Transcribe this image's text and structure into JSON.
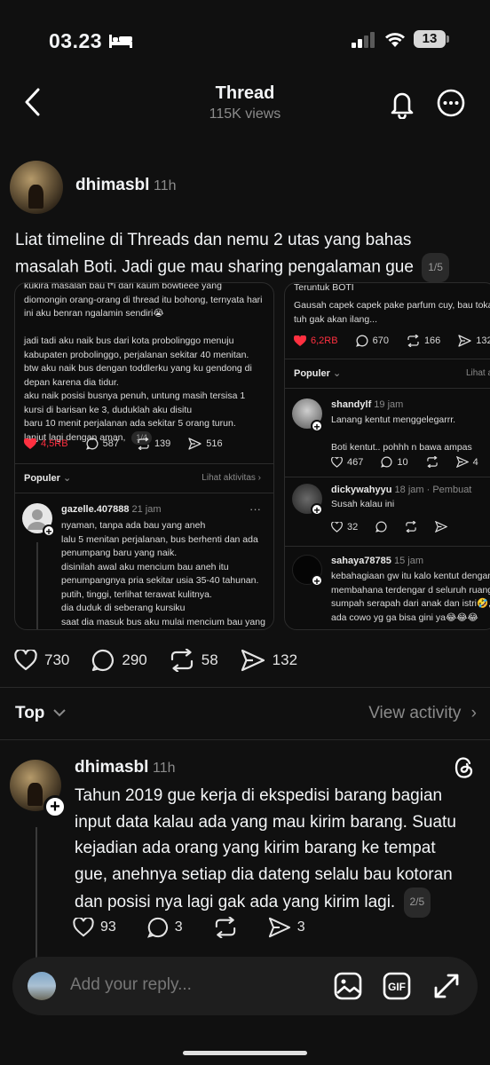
{
  "status_bar": {
    "time": "03.23",
    "battery": "13"
  },
  "header": {
    "title": "Thread",
    "views": "115K views"
  },
  "post": {
    "username": "dhimasbl",
    "time": "11h",
    "text": "Liat timeline di Threads dan nemu 2 utas yang bahas masalah Boti. Jadi gue mau sharing pengalaman gue",
    "pager": "1/5",
    "likes": "730",
    "comments": "290",
    "reposts": "58",
    "shares": "132"
  },
  "shot1": {
    "body": "kukira masalah bau t*i dari kaum bowtieee yang\ndiomongin orang-orang di thread itu bohong, ternyata hari\nini aku benran ngalamin sendiri😭\n\njadi tadi aku naik bus dari kota probolinggo menuju\nkabupaten probolinggo, perjalanan sekitar 40 menitan.\nbtw aku naik bus dengan toddlerku yang ku gendong di\ndepan karena dia tidur.\naku naik posisi busnya penuh, untung masih tersisa 1\nkursi di barisan ke 3, duduklah aku disitu\nbaru 10 menit perjalanan ada sekitar 5 orang turun.\nlanjut lagi dengan aman,",
    "pager": "1/4",
    "likes": "4,5RB",
    "comments": "587",
    "reposts": "139",
    "shares": "516",
    "popular": "Populer",
    "activity": "Lihat aktivitas",
    "reply_user": "gazelle.407888",
    "reply_time": "21 jam",
    "reply_body": "nyaman, tanpa ada bau yang aneh\nlalu 5 menitan perjalanan, bus berhenti dan ada\npenumpang baru yang naik.\ndisinilah awal aku mencium bau aneh itu\npenumpangnya pria sekitar usia 35-40 tahunan.\nputih, tinggi, terlihat terawat kulitnya.\ndia duduk di seberang kursiku\nsaat dia masuk bus aku mulai mencium bau yang\naneh, seperti bau toilet umum, mirip juga dengan"
  },
  "shot2": {
    "header": "Teruntuk BOTI",
    "body": "Gausah capek capek pake parfum cuy, bau tokai k\ntuh gak akan ilang...",
    "likes": "6,2RB",
    "comments": "670",
    "reposts": "166",
    "shares": "132",
    "popular": "Populer",
    "activity": "Lihat at",
    "r1_user": "shandylf",
    "r1_time": "19 jam",
    "r1_body": "Lanang kentut menggelegarrr.\n\nBoti kentut.. pohhh n bawa ampas",
    "r1_likes": "467",
    "r1_comments": "10",
    "r1_shares": "4",
    "r2_user": "dickywahyyu",
    "r2_time": "18 jam · Pembuat",
    "r2_body": "Susah kalau ini",
    "r2_likes": "32",
    "r3_user": "sahaya78785",
    "r3_time": "15 jam",
    "r3_body": "kebahagiaan gw itu kalo kentut dengan s\nmembahana terdengar d seluruh ruanga\nsumpah serapah dari anak dan istri🤣, t\nada cowo yg ga bisa gini ya😂😂😂"
  },
  "filter": {
    "sort": "Top",
    "view_activity": "View activity"
  },
  "reply": {
    "username": "dhimasbl",
    "time": "11h",
    "text": "Tahun 2019 gue kerja di ekspedisi barang bagian input data kalau ada yang mau kirim barang. Suatu kejadian ada orang yang kirim barang ke tempat gue, anehnya setiap dia dateng selalu bau kotoran dan posisi nya lagi gak ada yang kirim lagi.",
    "pager": "2/5",
    "likes": "93",
    "comments": "3",
    "shares": "3"
  },
  "compose": {
    "placeholder": "Add your reply..."
  },
  "colors": {
    "background": "#101010",
    "like_red": "#ff3040",
    "muted": "#8b8b8b"
  }
}
